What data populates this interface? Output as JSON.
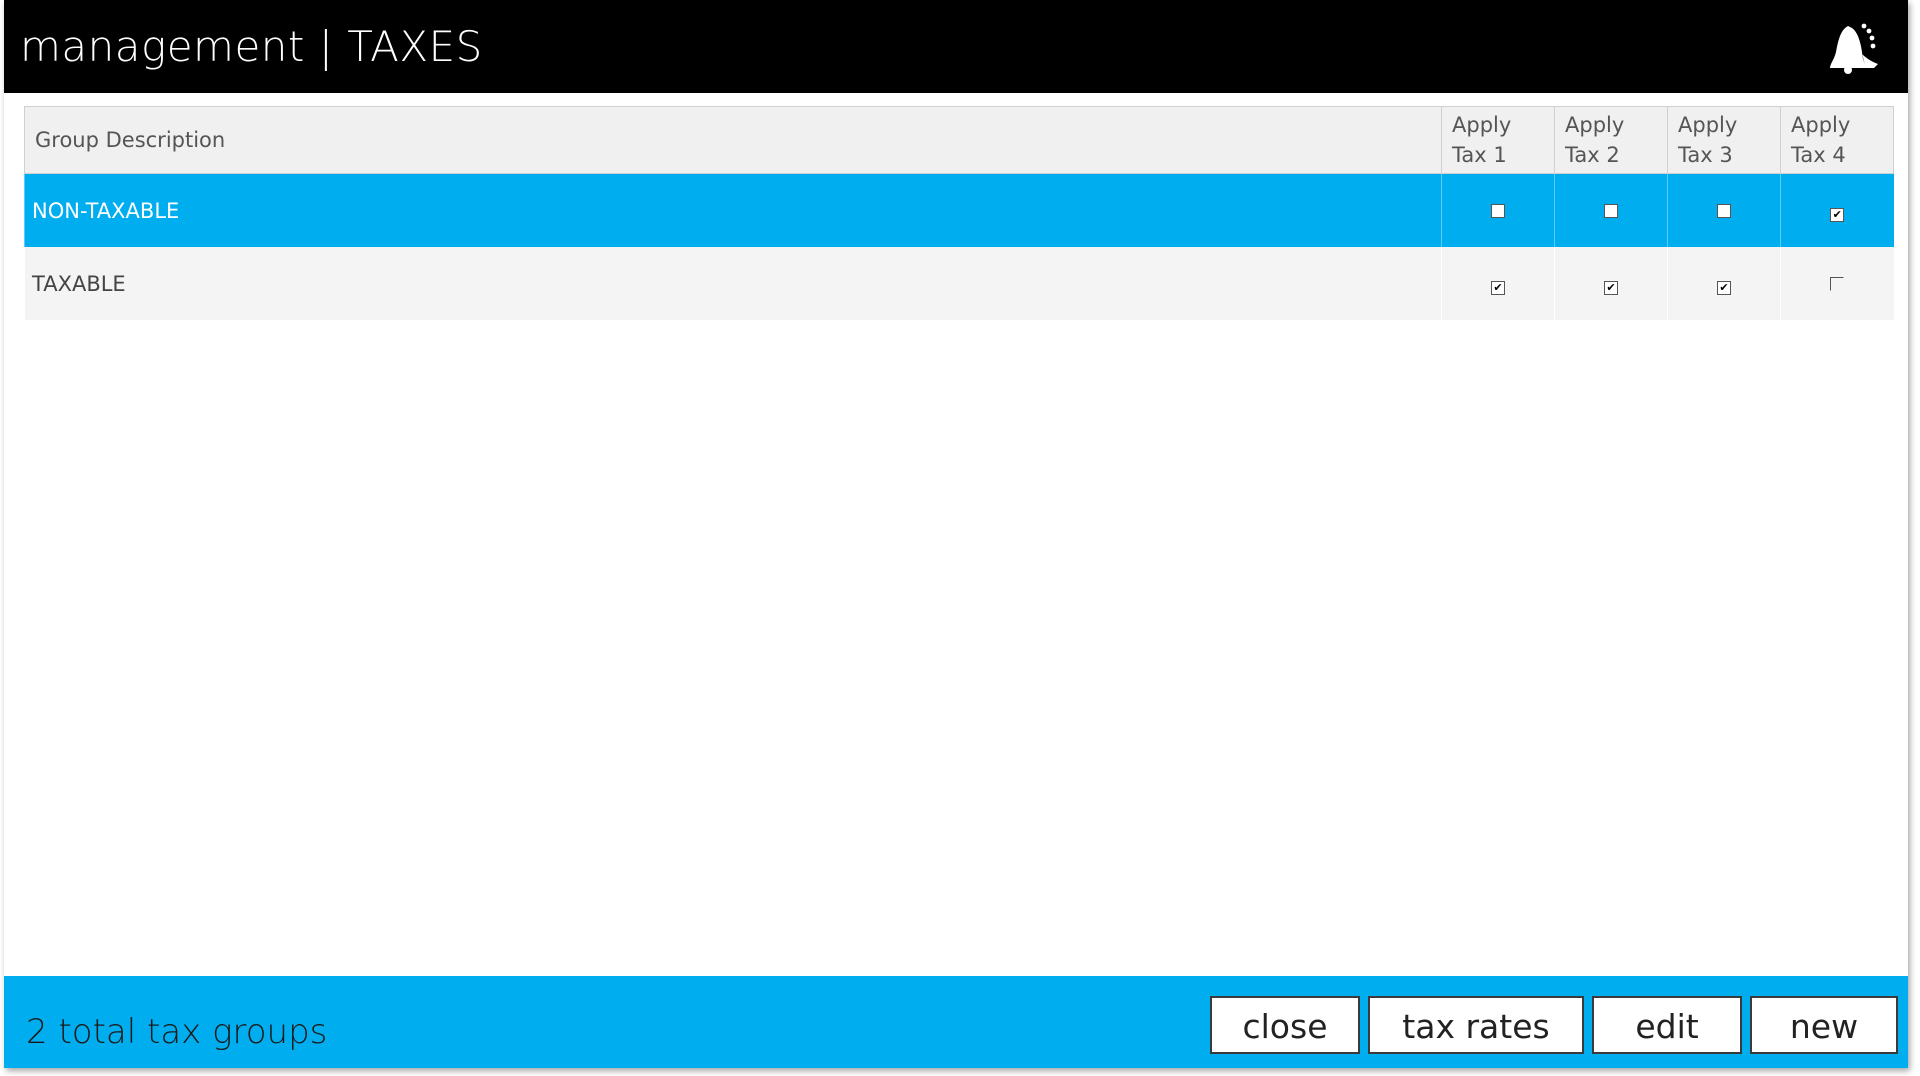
{
  "header": {
    "title": "management | TAXES",
    "logo_icon": "bell-logo-icon"
  },
  "table": {
    "columns": [
      {
        "label": "Group Description"
      },
      {
        "line1": "Apply",
        "line2": "Tax 1"
      },
      {
        "line1": "Apply",
        "line2": "Tax 2"
      },
      {
        "line1": "Apply",
        "line2": "Tax 3"
      },
      {
        "line1": "Apply",
        "line2": "Tax 4"
      }
    ],
    "rows": [
      {
        "description": "NON-TAXABLE",
        "selected": true,
        "apply": [
          false,
          false,
          false,
          true
        ]
      },
      {
        "description": "TAXABLE",
        "selected": false,
        "apply": [
          true,
          true,
          true,
          false
        ]
      }
    ]
  },
  "footer": {
    "count_text": "2 total tax groups",
    "buttons": {
      "close": "close",
      "tax_rates": "tax rates",
      "edit": "edit",
      "new": "new"
    }
  },
  "colors": {
    "accent": "#00adef",
    "titlebar": "#000000"
  }
}
